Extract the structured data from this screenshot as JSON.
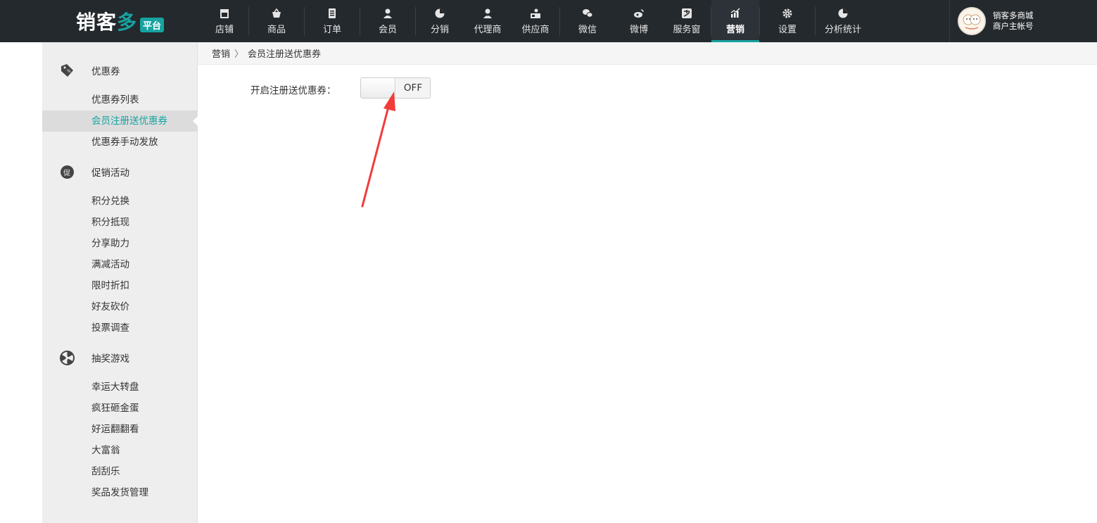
{
  "logo": {
    "text_main": "销客",
    "text_accent": "多",
    "badge": "平台"
  },
  "nav": [
    {
      "label": "店铺",
      "icon": "store-icon"
    },
    {
      "label": "商品",
      "icon": "basket-icon"
    },
    {
      "label": "订单",
      "icon": "order-icon"
    },
    {
      "label": "会员",
      "icon": "user-icon"
    },
    {
      "label": "分销",
      "icon": "pie-icon"
    },
    {
      "label": "代理商",
      "icon": "agent-icon"
    },
    {
      "label": "供应商",
      "icon": "supplier-icon"
    },
    {
      "label": "微信",
      "icon": "wechat-icon"
    },
    {
      "label": "微博",
      "icon": "weibo-icon"
    },
    {
      "label": "服务窗",
      "icon": "alipay-icon"
    },
    {
      "label": "营销",
      "icon": "chart-icon",
      "active": true
    },
    {
      "label": "设置",
      "icon": "gear-icon"
    },
    {
      "label": "分析统计",
      "icon": "pie-icon"
    }
  ],
  "account": {
    "name": "销客多商城",
    "role": "商户主帐号"
  },
  "sidebar": {
    "groups": [
      {
        "label": "优惠券",
        "icon": "coupon-tag-icon",
        "items": [
          "优惠券列表",
          "会员注册送优惠券",
          "优惠券手动发放"
        ]
      },
      {
        "label": "促销活动",
        "icon": "promotion-icon",
        "items": [
          "积分兑换",
          "积分抵现",
          "分享助力",
          "满减活动",
          "限时折扣",
          "好友砍价",
          "投票调查"
        ]
      },
      {
        "label": "抽奖游戏",
        "icon": "lottery-wheel-icon",
        "items": [
          "幸运大转盘",
          "疯狂砸金蛋",
          "好运翻翻看",
          "大富翁",
          "刮刮乐",
          "奖品发货管理"
        ]
      }
    ],
    "active_item": "会员注册送优惠券"
  },
  "breadcrumb": {
    "parent": "营销",
    "separator": "〉",
    "current": "会员注册送优惠券"
  },
  "form": {
    "label": "开启注册送优惠券：",
    "toggle_state": "OFF"
  },
  "colors": {
    "topbar": "#24292d",
    "accent": "#17a3a0",
    "sidebar": "#eeeeee",
    "annotation_arrow": "#f23b3b"
  }
}
